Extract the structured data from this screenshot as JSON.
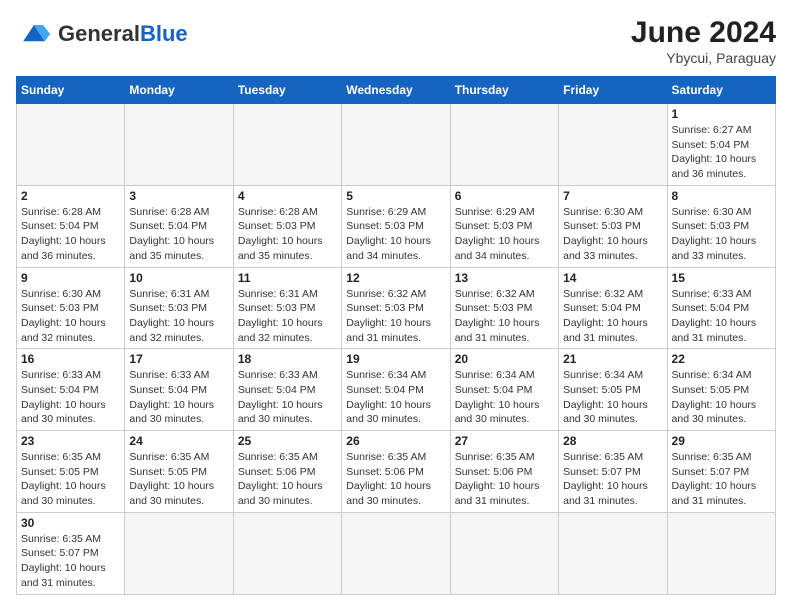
{
  "header": {
    "logo_general": "General",
    "logo_blue": "Blue",
    "month_year": "June 2024",
    "location": "Ybycui, Paraguay"
  },
  "weekdays": [
    "Sunday",
    "Monday",
    "Tuesday",
    "Wednesday",
    "Thursday",
    "Friday",
    "Saturday"
  ],
  "weeks": [
    [
      {
        "day": "",
        "info": ""
      },
      {
        "day": "",
        "info": ""
      },
      {
        "day": "",
        "info": ""
      },
      {
        "day": "",
        "info": ""
      },
      {
        "day": "",
        "info": ""
      },
      {
        "day": "",
        "info": ""
      },
      {
        "day": "1",
        "info": "Sunrise: 6:27 AM\nSunset: 5:04 PM\nDaylight: 10 hours and 36 minutes."
      }
    ],
    [
      {
        "day": "2",
        "info": "Sunrise: 6:28 AM\nSunset: 5:04 PM\nDaylight: 10 hours and 36 minutes."
      },
      {
        "day": "3",
        "info": "Sunrise: 6:28 AM\nSunset: 5:04 PM\nDaylight: 10 hours and 35 minutes."
      },
      {
        "day": "4",
        "info": "Sunrise: 6:28 AM\nSunset: 5:03 PM\nDaylight: 10 hours and 35 minutes."
      },
      {
        "day": "5",
        "info": "Sunrise: 6:29 AM\nSunset: 5:03 PM\nDaylight: 10 hours and 34 minutes."
      },
      {
        "day": "6",
        "info": "Sunrise: 6:29 AM\nSunset: 5:03 PM\nDaylight: 10 hours and 34 minutes."
      },
      {
        "day": "7",
        "info": "Sunrise: 6:30 AM\nSunset: 5:03 PM\nDaylight: 10 hours and 33 minutes."
      },
      {
        "day": "8",
        "info": "Sunrise: 6:30 AM\nSunset: 5:03 PM\nDaylight: 10 hours and 33 minutes."
      }
    ],
    [
      {
        "day": "9",
        "info": "Sunrise: 6:30 AM\nSunset: 5:03 PM\nDaylight: 10 hours and 32 minutes."
      },
      {
        "day": "10",
        "info": "Sunrise: 6:31 AM\nSunset: 5:03 PM\nDaylight: 10 hours and 32 minutes."
      },
      {
        "day": "11",
        "info": "Sunrise: 6:31 AM\nSunset: 5:03 PM\nDaylight: 10 hours and 32 minutes."
      },
      {
        "day": "12",
        "info": "Sunrise: 6:32 AM\nSunset: 5:03 PM\nDaylight: 10 hours and 31 minutes."
      },
      {
        "day": "13",
        "info": "Sunrise: 6:32 AM\nSunset: 5:03 PM\nDaylight: 10 hours and 31 minutes."
      },
      {
        "day": "14",
        "info": "Sunrise: 6:32 AM\nSunset: 5:04 PM\nDaylight: 10 hours and 31 minutes."
      },
      {
        "day": "15",
        "info": "Sunrise: 6:33 AM\nSunset: 5:04 PM\nDaylight: 10 hours and 31 minutes."
      }
    ],
    [
      {
        "day": "16",
        "info": "Sunrise: 6:33 AM\nSunset: 5:04 PM\nDaylight: 10 hours and 30 minutes."
      },
      {
        "day": "17",
        "info": "Sunrise: 6:33 AM\nSunset: 5:04 PM\nDaylight: 10 hours and 30 minutes."
      },
      {
        "day": "18",
        "info": "Sunrise: 6:33 AM\nSunset: 5:04 PM\nDaylight: 10 hours and 30 minutes."
      },
      {
        "day": "19",
        "info": "Sunrise: 6:34 AM\nSunset: 5:04 PM\nDaylight: 10 hours and 30 minutes."
      },
      {
        "day": "20",
        "info": "Sunrise: 6:34 AM\nSunset: 5:04 PM\nDaylight: 10 hours and 30 minutes."
      },
      {
        "day": "21",
        "info": "Sunrise: 6:34 AM\nSunset: 5:05 PM\nDaylight: 10 hours and 30 minutes."
      },
      {
        "day": "22",
        "info": "Sunrise: 6:34 AM\nSunset: 5:05 PM\nDaylight: 10 hours and 30 minutes."
      }
    ],
    [
      {
        "day": "23",
        "info": "Sunrise: 6:35 AM\nSunset: 5:05 PM\nDaylight: 10 hours and 30 minutes."
      },
      {
        "day": "24",
        "info": "Sunrise: 6:35 AM\nSunset: 5:05 PM\nDaylight: 10 hours and 30 minutes."
      },
      {
        "day": "25",
        "info": "Sunrise: 6:35 AM\nSunset: 5:06 PM\nDaylight: 10 hours and 30 minutes."
      },
      {
        "day": "26",
        "info": "Sunrise: 6:35 AM\nSunset: 5:06 PM\nDaylight: 10 hours and 30 minutes."
      },
      {
        "day": "27",
        "info": "Sunrise: 6:35 AM\nSunset: 5:06 PM\nDaylight: 10 hours and 31 minutes."
      },
      {
        "day": "28",
        "info": "Sunrise: 6:35 AM\nSunset: 5:07 PM\nDaylight: 10 hours and 31 minutes."
      },
      {
        "day": "29",
        "info": "Sunrise: 6:35 AM\nSunset: 5:07 PM\nDaylight: 10 hours and 31 minutes."
      }
    ],
    [
      {
        "day": "30",
        "info": "Sunrise: 6:35 AM\nSunset: 5:07 PM\nDaylight: 10 hours and 31 minutes."
      },
      {
        "day": "",
        "info": ""
      },
      {
        "day": "",
        "info": ""
      },
      {
        "day": "",
        "info": ""
      },
      {
        "day": "",
        "info": ""
      },
      {
        "day": "",
        "info": ""
      },
      {
        "day": "",
        "info": ""
      }
    ]
  ]
}
